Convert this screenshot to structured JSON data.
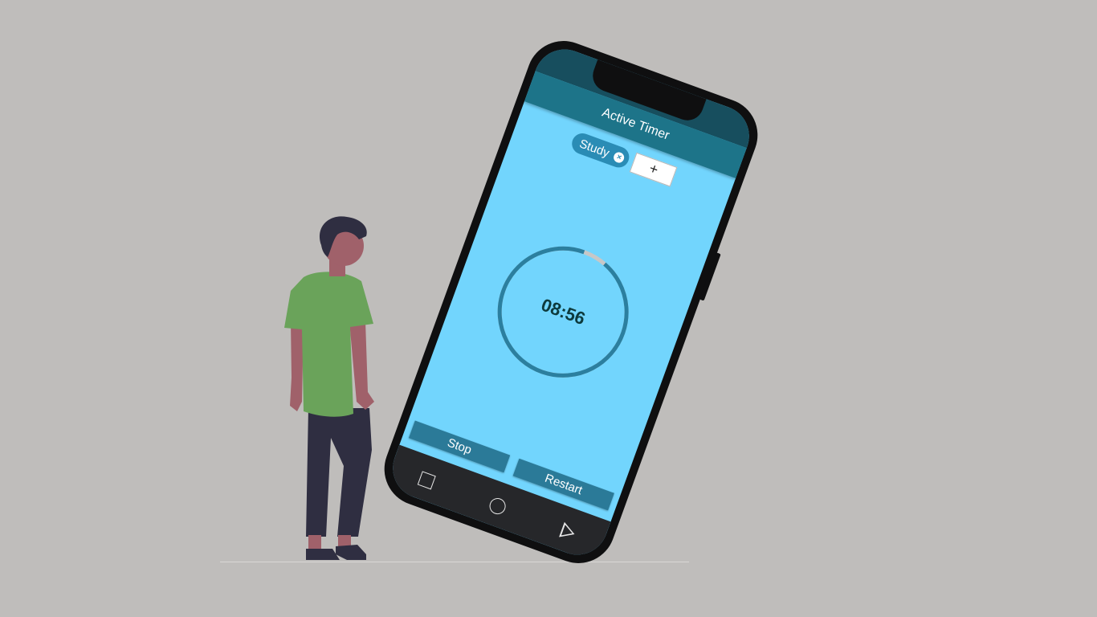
{
  "app": {
    "title": "Active Timer"
  },
  "tags": [
    {
      "label": "Study",
      "remove_icon": "close-icon"
    }
  ],
  "add_tag": {
    "label": "+"
  },
  "timer": {
    "display": "08:56",
    "progress_fraction": 0.94
  },
  "actions": {
    "stop_label": "Stop",
    "restart_label": "Restart"
  },
  "navbar": {
    "icons": [
      "recent-apps-icon",
      "home-icon",
      "back-icon"
    ]
  },
  "colors": {
    "background": "#bfbdbb",
    "screen": "#72d5fd",
    "app_bar": "#1d7489",
    "chip": "#2a8cb5",
    "ring": "#2b7f9f",
    "ring_remaining": "#c7c7c7",
    "action_button": "#2b7a98",
    "shirt": "#6aa35a",
    "pants": "#2f2e41",
    "skin": "#a0616a",
    "hair": "#2f2e41"
  }
}
